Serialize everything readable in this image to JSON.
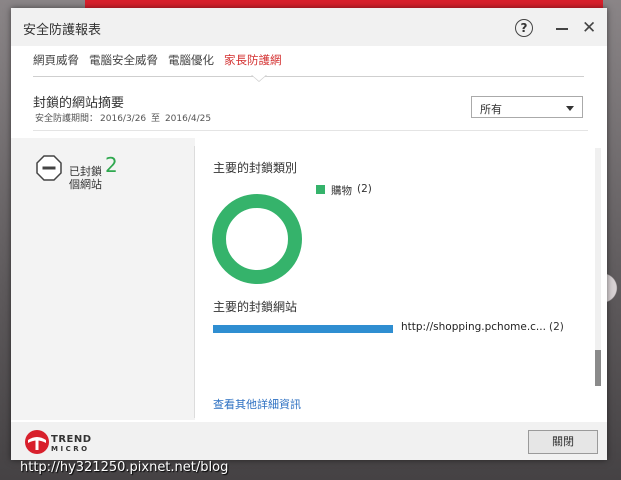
{
  "window": {
    "title": "安全防護報表",
    "help_glyph": "?",
    "close_glyph": "✕"
  },
  "tabs": [
    {
      "label": "網頁威脅"
    },
    {
      "label": "電腦安全威脅"
    },
    {
      "label": "電腦優化"
    },
    {
      "label": "家長防護網"
    }
  ],
  "summary": {
    "title": "封鎖的網站摘要",
    "period_label": "安全防護期間：",
    "period_start": "2016/3/26",
    "period_sep": "至",
    "period_end": "2016/4/25"
  },
  "filter": {
    "selected": "所有"
  },
  "blocked": {
    "label_prefix": "已封鎖",
    "count": "2",
    "label_suffix": "個網站"
  },
  "categories": {
    "heading": "主要的封鎖類別",
    "items": [
      {
        "name": "購物",
        "count": "(2)",
        "color": "#35b36b",
        "share": 1.0
      }
    ]
  },
  "sites": {
    "heading": "主要的封鎖網站",
    "items": [
      {
        "url": "http://shopping.pchome.c...",
        "count": "(2)",
        "color": "#2f8ed1",
        "share": 1.0
      }
    ]
  },
  "more_link": "查看其他詳細資訊",
  "footer": {
    "brand_line1": "TREND",
    "brand_line2": "MICRO",
    "close_button": "關閉"
  },
  "watermark": "http://hy321250.pixnet.net/blog",
  "colors": {
    "accent_red": "#d32f2f",
    "category_green": "#35b36b",
    "site_blue": "#2f8ed1",
    "link_blue": "#2b6fc2",
    "count_green": "#2fa84f"
  }
}
